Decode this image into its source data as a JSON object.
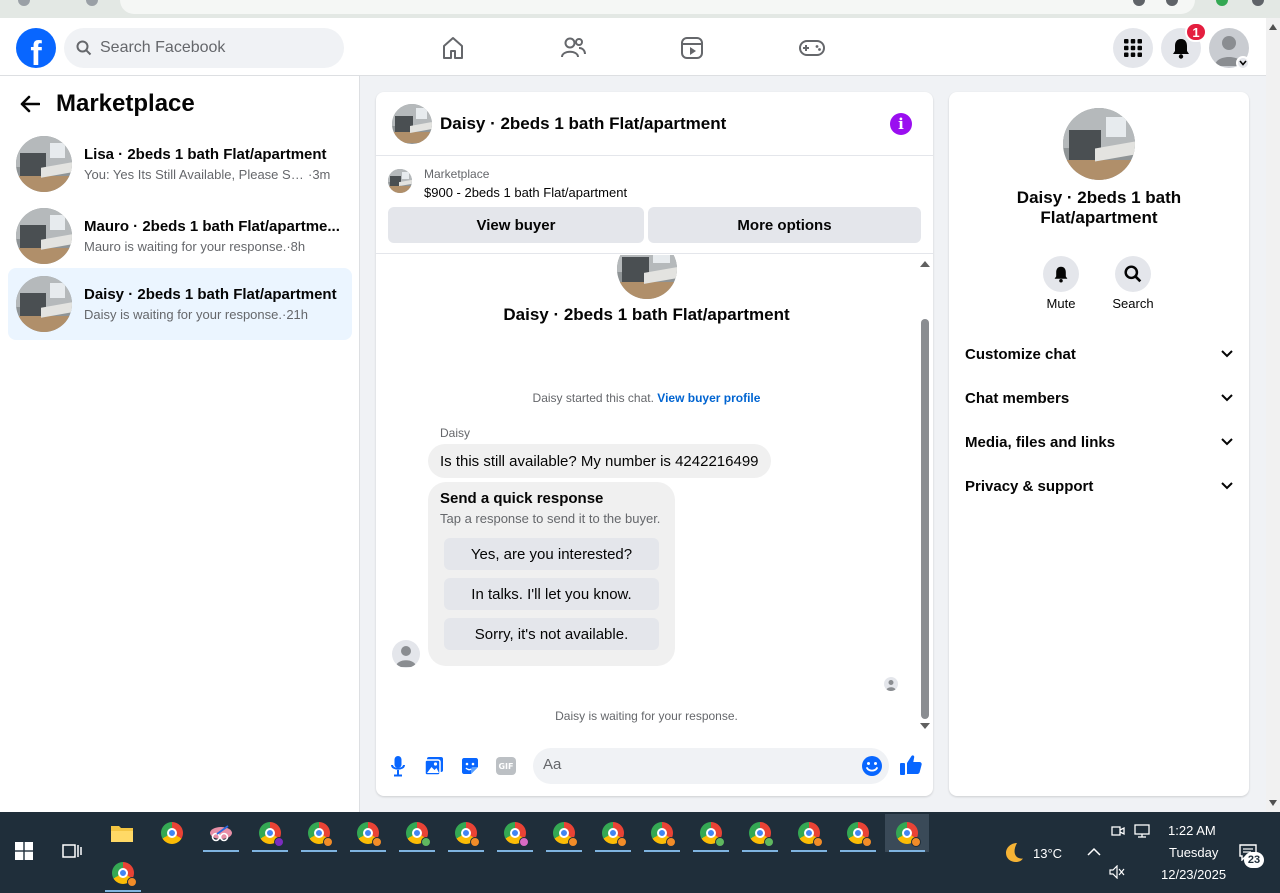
{
  "header": {
    "logo_letter": "f",
    "search_placeholder": "Search Facebook",
    "notification_count": "1"
  },
  "sidebar": {
    "title": "Marketplace",
    "conversations": [
      {
        "title": "Lisa · 2beds 1 bath Flat/apartment",
        "snippet": "You: Yes Its Still Available, Please Sen...",
        "time": "·3m",
        "active": false
      },
      {
        "title": "Mauro · 2beds 1 bath Flat/apartme...",
        "snippet": "Mauro is waiting for your response.",
        "time": "·8h",
        "active": false
      },
      {
        "title": "Daisy · 2beds 1 bath Flat/apartment",
        "snippet": "Daisy is waiting for your response.",
        "time": "·21h",
        "active": true
      }
    ]
  },
  "chat": {
    "title": "Daisy · 2beds 1 bath Flat/apartment",
    "info_glyph": "i",
    "marketplace_label": "Marketplace",
    "listing_price_title": "$900 - 2beds 1 bath Flat/apartment",
    "view_buyer_label": "View buyer",
    "more_options_label": "More options",
    "intro_name": "Daisy · 2beds 1 bath Flat/apartment",
    "started_text": "Daisy started this chat.",
    "view_profile_link": "View buyer profile",
    "sender_name": "Daisy",
    "message": "Is this still available? My number is 4242216499",
    "quick_title": "Send a quick response",
    "quick_subtitle": "Tap a response to send it to the buyer.",
    "quick_responses": [
      "Yes, are you interested?",
      "In talks. I'll let you know.",
      "Sorry, it's not available."
    ],
    "waiting_text": "Daisy is waiting for your response.",
    "composer_placeholder": "Aa",
    "gif_label": "GIF"
  },
  "details": {
    "name": "Daisy · 2beds 1 bath Flat/apartment",
    "mute_label": "Mute",
    "search_label": "Search",
    "sections": [
      "Customize chat",
      "Chat members",
      "Media, files and links",
      "Privacy & support"
    ]
  },
  "taskbar": {
    "weather": "13°C",
    "time": "1:22 AM",
    "day": "Tuesday",
    "date": "12/23/2025",
    "notification_count": "23"
  },
  "colors": {
    "brand_blue": "#0866ff",
    "link_blue": "#0064d1",
    "info_purple": "#9a0ef0",
    "badge_red": "#e41e3f",
    "active_row": "#ebf5ff",
    "taskbar_bg": "#1f2e3a"
  }
}
